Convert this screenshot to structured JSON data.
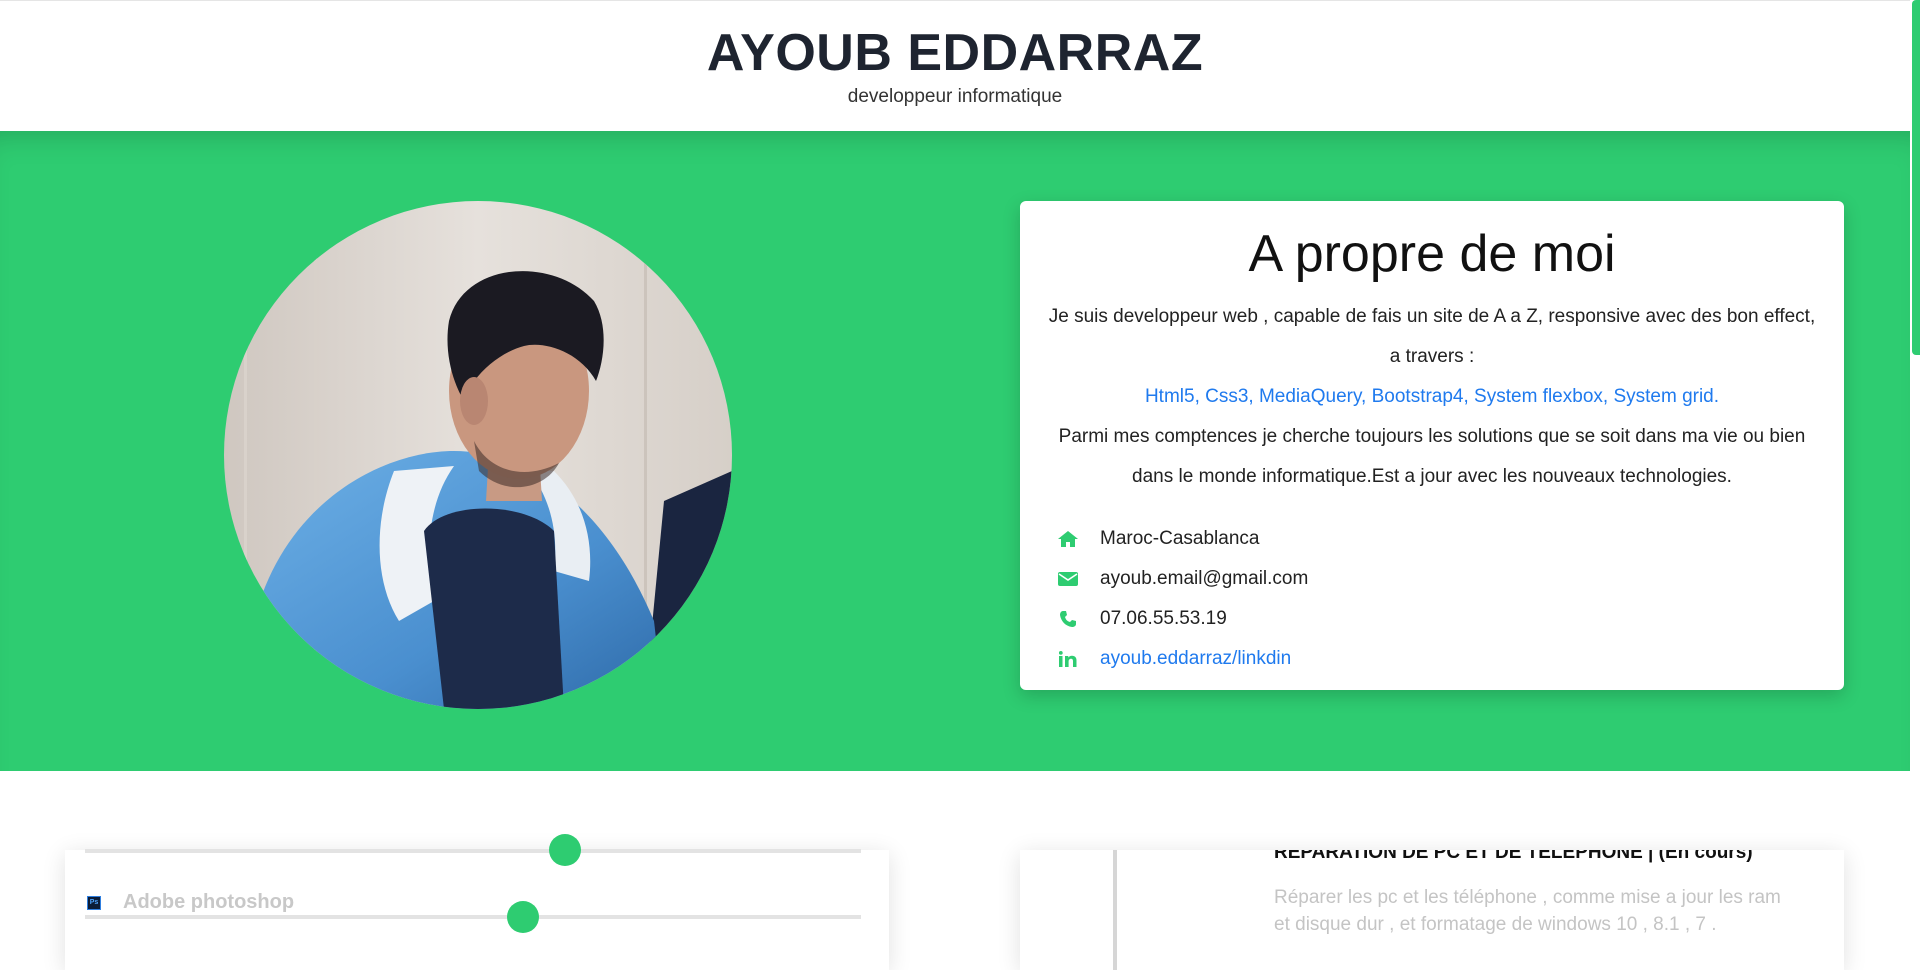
{
  "header": {
    "name": "AYOUB EDDARRAZ",
    "subtitle": "developpeur informatique"
  },
  "hero": {
    "background_color": "#2ecc71",
    "photo_alt": "profile-photo"
  },
  "about": {
    "title": "A propre de moi",
    "intro": "Je suis developpeur web , capable de fais un site de A a Z, responsive avec des bon effect, a travers :",
    "skills": "Html5, Css3, MediaQuery, Bootstrap4, System flexbox, System grid.",
    "paragraph": "Parmi mes comptences je cherche toujours les solutions que se soit dans ma vie ou bien dans le monde informatique.Est a jour avec les nouveaux technologies.",
    "contacts": [
      {
        "icon": "home-icon",
        "text": "Maroc-Casablanca",
        "link": false
      },
      {
        "icon": "envelope-icon",
        "text": "ayoub.email@gmail.com",
        "link": false
      },
      {
        "icon": "phone-icon",
        "text": "07.06.55.53.19",
        "link": false
      },
      {
        "icon": "linkedin-icon",
        "text": "ayoub.eddarraz/linkdin",
        "link": true
      }
    ]
  },
  "skills": {
    "items": [
      {
        "label": "",
        "level": 0.6
      },
      {
        "label": "Adobe photoshop",
        "icon": "photoshop-icon",
        "icon_text": "Ps",
        "level": 0.56
      }
    ]
  },
  "experience": {
    "title": "REPARATION DE PC ET DE TELEPHONE | (En cours)",
    "description": "Réparer les pc et les téléphone , comme mise a jour les ram et disque dur , et formatage de windows 10 , 8.1 , 7 ."
  },
  "colors": {
    "accent": "#2ecc71",
    "link": "#1f7aee",
    "heading": "#1e2430"
  }
}
